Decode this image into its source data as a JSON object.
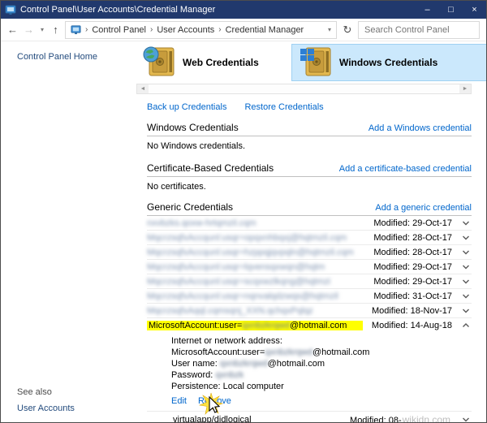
{
  "window": {
    "title": "Control Panel\\User Accounts\\Credential Manager"
  },
  "icons": {
    "back": "←",
    "forward": "→",
    "up": "↑",
    "dropdown": "▾",
    "refresh": "↻",
    "separator": "›",
    "minimize": "–",
    "maximize": "□",
    "close": "×",
    "scroll_left": "◄",
    "scroll_right": "►"
  },
  "navbar": {
    "breadcrumb": {
      "items": [
        "Control Panel",
        "User Accounts",
        "Credential Manager"
      ]
    },
    "search": {
      "placeholder": "Search Control Panel"
    }
  },
  "sidebar": {
    "home_link": "Control Panel Home",
    "see_also_header": "See also",
    "user_accounts_link": "User Accounts"
  },
  "tabs": {
    "web": "Web Credentials",
    "windows": "Windows Credentials"
  },
  "toolbar_links": {
    "backup": "Back up Credentials",
    "restore": "Restore Credentials"
  },
  "labels": {
    "modified": "Modified:"
  },
  "sections": {
    "windows": {
      "title": "Windows Credentials",
      "add_link": "Add a Windows credential",
      "empty": "No Windows credentials."
    },
    "certificates": {
      "title": "Certificate-Based Credentials",
      "add_link": "Add a certificate-based credential",
      "empty": "No certificates."
    },
    "generic": {
      "title": "Generic Credentials",
      "add_link": "Add a generic credential"
    }
  },
  "generic_credentials": [
    {
      "name_redacted": "nxvbzks.qoxw-hrtqmzil.cqm",
      "modified": "29-Oct-17"
    },
    {
      "name_redacted": "MqcrzsqfxAccqunl:usqr=opqxnhbqxj@hqtmzil.cqm",
      "modified": "28-Oct-17"
    },
    {
      "name_redacted": "MqcrzsqfxAccqunl:usqr=hzppqjqvpqln@hqtmzil.cqm",
      "modified": "28-Oct-17"
    },
    {
      "name_redacted": "MqcrzsqfxAccqunl:usqr=lqvensqxwqn@hqtm",
      "modified": "29-Oct-17"
    },
    {
      "name_redacted": "MqcrzsqfxAccqunl:usqr=scqxwzlkqng@hqtmzi",
      "modified": "29-Oct-17"
    },
    {
      "name_redacted": "MqcrzsqfxAccqunl:usqr=nqnvalqdzwqs@hqtmzil",
      "modified": "31-Oct-17"
    },
    {
      "name_redacted": "MqcrzsqfxAqql.cqmsqnj_XXN.qchqxPqlqz",
      "modified": "18-Nov-17"
    }
  ],
  "expanded_credential": {
    "name_prefix": "MicrosoftAccount:user=",
    "name_redacted": "qxnbzkrqwd",
    "name_suffix": "@hotmail.com",
    "modified": "14-Aug-18",
    "details": {
      "address_label": "Internet or network address:",
      "address_prefix": "MicrosoftAccount:user=",
      "address_redacted": "qxnbzkrqwd",
      "address_suffix": "@hotmail.com",
      "username_label": "User name:",
      "username_redacted": "qxnbzkrqwd",
      "username_suffix": "@hotmail.com",
      "password_label": "Password:",
      "password_redacted": "qxnbzk",
      "persistence_label": "Persistence:",
      "persistence_value": "Local computer",
      "edit_link": "Edit",
      "remove_link": "Remove"
    }
  },
  "bottom_credential": {
    "name": "virtualapp/didlogical",
    "modified": "08-"
  },
  "watermark": "wikidn.com"
}
